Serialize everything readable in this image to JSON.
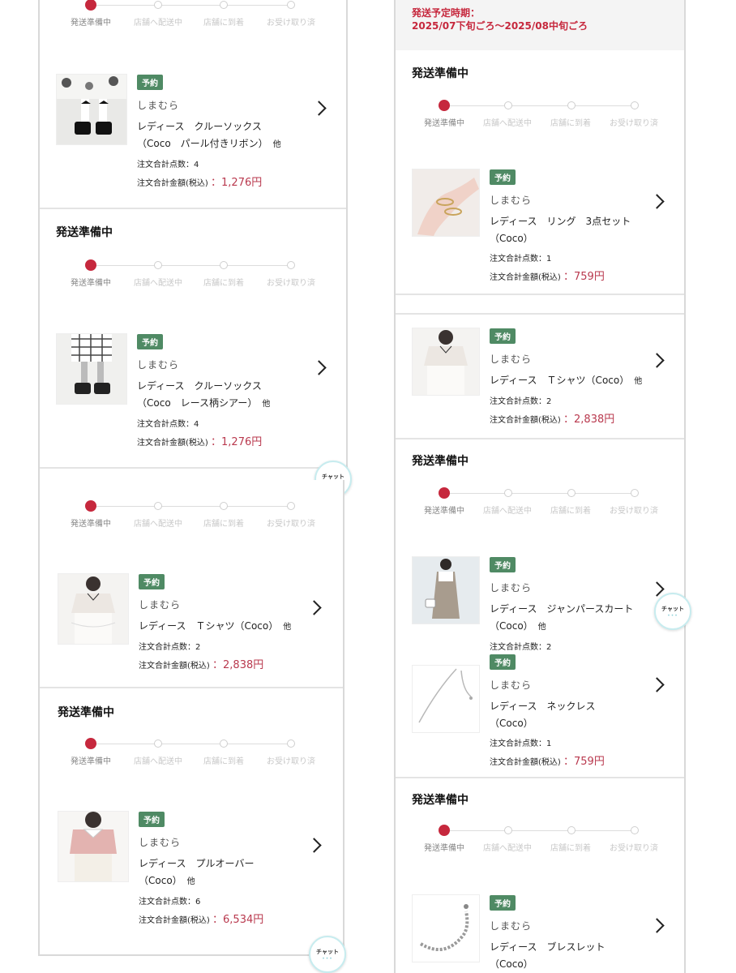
{
  "tracker_steps": [
    "発送準備中",
    "店舗へ配送中",
    "店舗に到着",
    "お受け取り済"
  ],
  "status_title": "発送準備中",
  "badge": "予約",
  "shop": "しまむら",
  "labels": {
    "count": "注文合計点数：",
    "amount": "注文合計金額(税込)",
    "sep": "：",
    "other": "他"
  },
  "shipping_notice": {
    "line1": "発送予定時期：",
    "line2": "2025/07下旬ごろ〜2025/08中旬ごろ"
  },
  "chat": {
    "label": "チャット",
    "dots": "•••"
  },
  "orders": [
    {
      "name1": "レディース　クルーソックス",
      "name2": "（Coco　パール付きリボン）",
      "other": true,
      "count": "4",
      "amount": "1,276円"
    },
    {
      "name1": "レディース　クルーソックス",
      "name2": "（Coco　レース柄シアー）",
      "other": true,
      "count": "4",
      "amount": "1,276円"
    },
    {
      "name1": "レディース　Ｔシャツ（Coco）",
      "name2": "",
      "other": true,
      "count": "2",
      "amount": "2,838円"
    },
    {
      "name1": "レディース　プルオーバー",
      "name2": "（Coco）",
      "other": true,
      "count": "6",
      "amount": "6,534円"
    },
    {
      "name1": "レディース　リング　3点セット",
      "name2": "（Coco）",
      "other": false,
      "count": "1",
      "amount": "759円"
    },
    {
      "name1": "レディース　Ｔシャツ（Coco）",
      "name2": "",
      "other": true,
      "count": "2",
      "amount": "2,838円"
    },
    {
      "name1": "レディース　ジャンパースカート",
      "name2": "（Coco）",
      "other": true,
      "count": "2",
      "amount": ""
    },
    {
      "name1": "レディース　ネックレス",
      "name2": "（Coco）",
      "other": false,
      "count": "1",
      "amount": "759円"
    },
    {
      "name1": "レディース　ブレスレット",
      "name2": "（Coco）",
      "other": false,
      "count": "",
      "amount": ""
    }
  ],
  "colors": {
    "accent": "#c6283d",
    "badge": "#4f8a64",
    "price": "#b9394e"
  }
}
